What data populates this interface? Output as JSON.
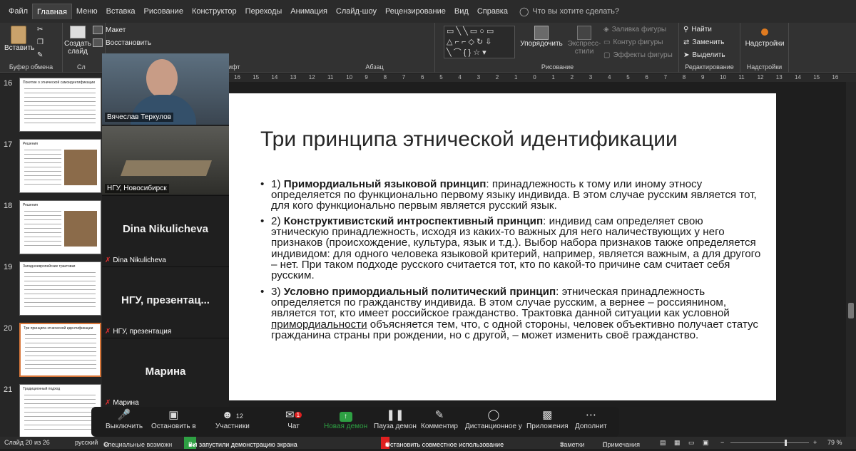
{
  "menu": {
    "items": [
      "Файл",
      "Главная",
      "Меню",
      "Вставка",
      "Рисование",
      "Конструктор",
      "Переходы",
      "Анимация",
      "Слайд-шоу",
      "Рецензирование",
      "Вид",
      "Справка"
    ],
    "active_index": 1,
    "tell_me": "Что вы хотите сделать?"
  },
  "ribbon": {
    "paste": "Вставить",
    "clipboard": "Буфер обмена",
    "create_slide": "Создать слайд",
    "layout": "Макет",
    "restore": "Восстановить",
    "slides_group": "Сл",
    "font_group": "ифт",
    "paragraph": "Абзац",
    "arrange": "Упорядочить",
    "express_styles": "Экспресс-стили",
    "drawing": "Рисование",
    "shape_fill": "Заливка фигуры",
    "shape_outline": "Контур фигуры",
    "shape_effects": "Эффекты фигуры",
    "find": "Найти",
    "replace": "Заменить",
    "select": "Выделить",
    "editing": "Редактирование",
    "addins_btn": "Надстройки",
    "addins_group": "Надстройки"
  },
  "ruler_marks": [
    "16",
    "15",
    "14",
    "13",
    "12",
    "11",
    "10",
    "9",
    "8",
    "7",
    "6",
    "5",
    "4",
    "3",
    "2",
    "1",
    "0",
    "1",
    "2",
    "3",
    "4",
    "5",
    "6",
    "7",
    "8",
    "9",
    "10",
    "11",
    "12",
    "13",
    "14",
    "15",
    "16"
  ],
  "thumbnails": [
    {
      "num": "16",
      "title": "Понятие о этнической самоидентификации"
    },
    {
      "num": "17",
      "title": "Решения"
    },
    {
      "num": "18",
      "title": "Решения"
    },
    {
      "num": "19",
      "title": "Западноевропейские трактовки"
    },
    {
      "num": "20",
      "title": "Три принципа этнической идентификации"
    },
    {
      "num": "21",
      "title": "Традиционный подход"
    }
  ],
  "video": {
    "tiles": [
      {
        "name": "Вячеслав Теркулов",
        "big": "",
        "muted": false
      },
      {
        "name": "НГУ, Новосибирск",
        "big": "",
        "muted": false
      },
      {
        "name": "Dina Nikulicheva",
        "big": "Dina Nikulicheva",
        "muted": true
      },
      {
        "name": "НГУ, презентация",
        "big": "НГУ,  презентац...",
        "muted": true
      },
      {
        "name": "Марина",
        "big": "Марина",
        "muted": true
      }
    ]
  },
  "slide": {
    "title": "Три принципа этнической идентификации",
    "bullets": [
      {
        "lead": "1) ",
        "bold": "Примордиальный языковой принцип",
        "rest": ": принадлежность к тому или иному этносу определяется по функционально первому языку индивида. В этом случае русским является тот, для кого функционально первым является русский язык."
      },
      {
        "lead": "2) ",
        "bold": "Конструктивистский интроспективный принцип",
        "rest": ": индивид сам определяет свою этническую принадлежность, исходя из каких-то важных для него наличествующих у него признаков (происхождение, культура, язык и т.д.). Выбор набора признаков также определяется индивидом: для одного человека языковой критерий, например, является важным, а для другого – нет. При таком подходе русского считается тот, кто по какой-то причине сам считает себя русским."
      },
      {
        "lead": "3) ",
        "bold": "Условно примордиальный политический принцип",
        "rest1": ": этническая принадлежность определяется по гражданству индивида. В этом случае русским, а вернее – россиянином, является тот, кто имеет российское гражданство. Трактовка данной ситуации как условной ",
        "underline": "примордиальности",
        "rest2": " объясняется тем, что, с одной стороны, человек объективно получает статус гражданина страны при рождении, но с другой, – может изменить своё гражданство."
      }
    ]
  },
  "zoom_toolbar": {
    "mute": "Выключить",
    "video": "Остановить в",
    "participants": "Участники",
    "participants_count": "12",
    "chat": "Чат",
    "chat_badge": "1",
    "new_share": "Новая демон",
    "pause_share": "Пауза демон",
    "annotate": "Комментир",
    "remote": "Дистанционное у",
    "apps": "Приложения",
    "more": "Дополнит"
  },
  "status": {
    "slide": "Слайд 20 из 26",
    "lang": "русский",
    "access": "Специальные возможн",
    "sharing": "Вы запустили демонстрацию экрана",
    "stop": "Остановить совместное использование",
    "notes": "Заметки",
    "comments": "Примечания",
    "zoom": "79 %"
  },
  "colors": {
    "accent": "#d9773a",
    "zoom_green": "#2ea043",
    "zoom_red": "#e02020"
  }
}
